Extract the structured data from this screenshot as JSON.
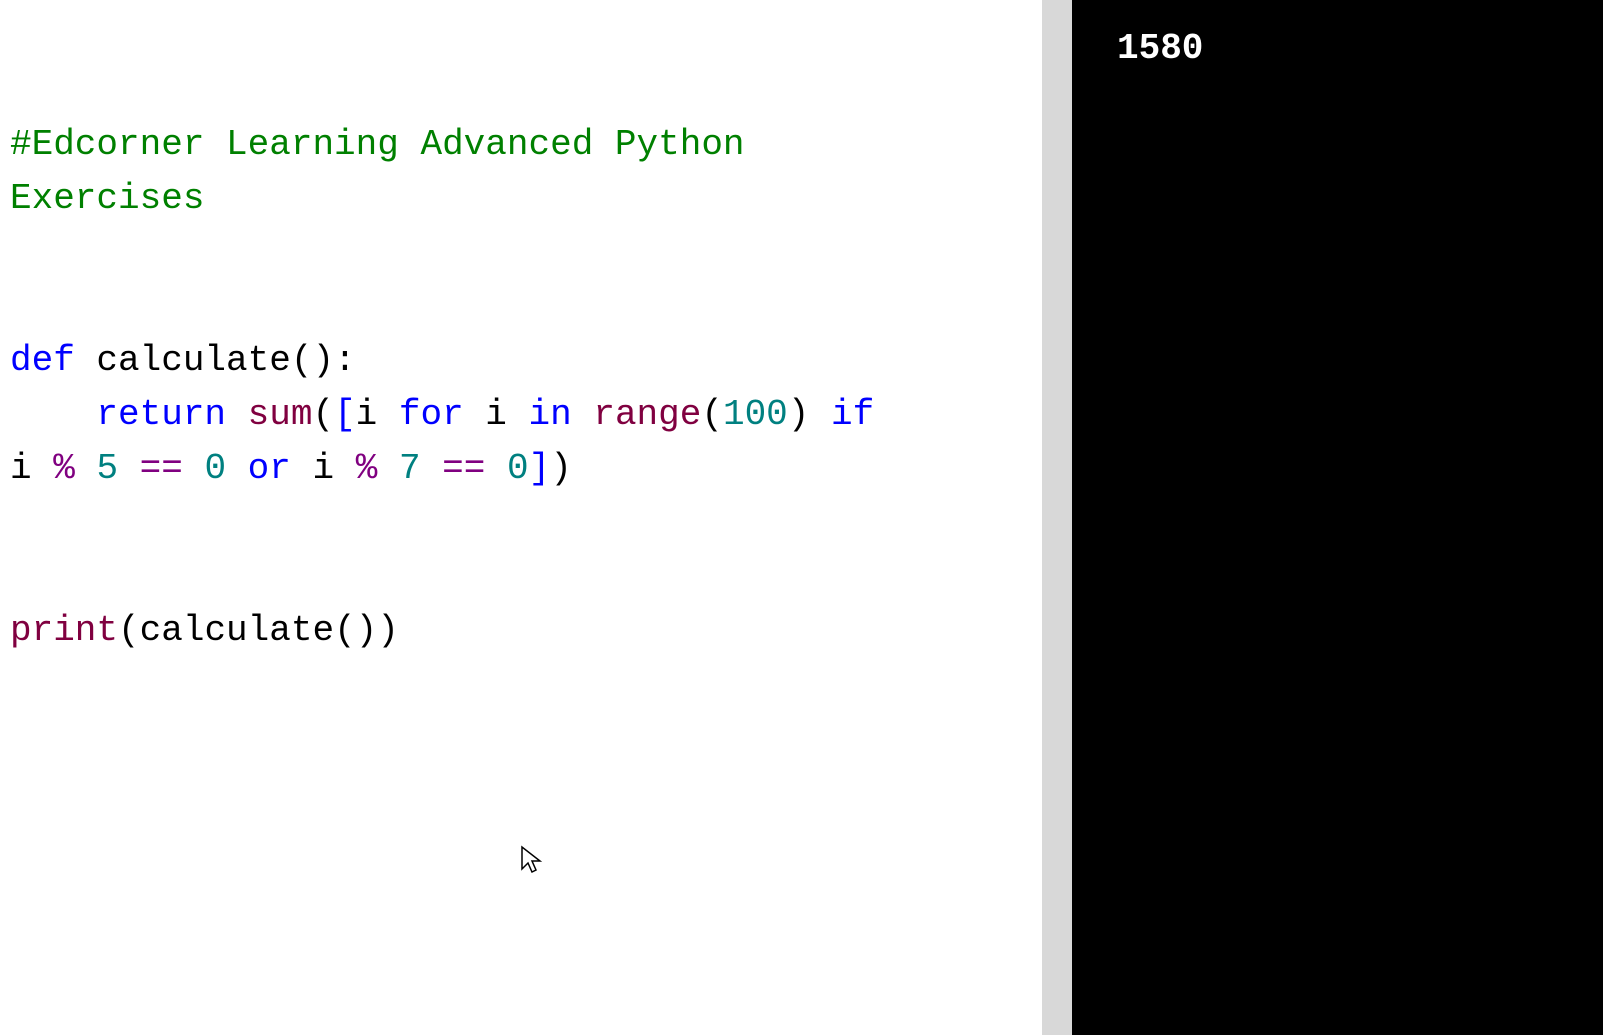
{
  "editor": {
    "comment_line1": "#Edcorner Learning Advanced Python",
    "comment_line2": "Exercises",
    "kw_def": "def",
    "fn_name": " calculate",
    "paren_open_colon": "():",
    "kw_return": "return",
    "fn_sum": " sum",
    "paren_open": "(",
    "bracket_open": "[",
    "var_i1": "i ",
    "kw_for": "for",
    "var_i2": " i ",
    "kw_in": "in",
    "fn_range": " range",
    "paren_open2": "(",
    "num_100": "100",
    "paren_close1": ") ",
    "kw_if": "if",
    "newline_space": " ",
    "var_i3": "i ",
    "op_mod1": "% ",
    "num_5": "5",
    "op_eq1": " == ",
    "num_0a": "0",
    "kw_or": " or ",
    "var_i4": "i ",
    "op_mod2": "% ",
    "num_7": "7",
    "op_eq2": " == ",
    "num_0b": "0",
    "bracket_close": "]",
    "paren_close2": ")",
    "fn_print": "print",
    "paren_open3": "(",
    "fn_calculate_call": "calculate",
    "paren_pair": "())"
  },
  "output": {
    "result": "1580"
  },
  "colors": {
    "comment": "#008000",
    "keyword": "#0000ff",
    "builtin": "#800040",
    "number": "#008080",
    "operator": "#800080",
    "editor_bg": "#ffffff",
    "output_bg": "#000000",
    "output_fg": "#ffffff"
  }
}
